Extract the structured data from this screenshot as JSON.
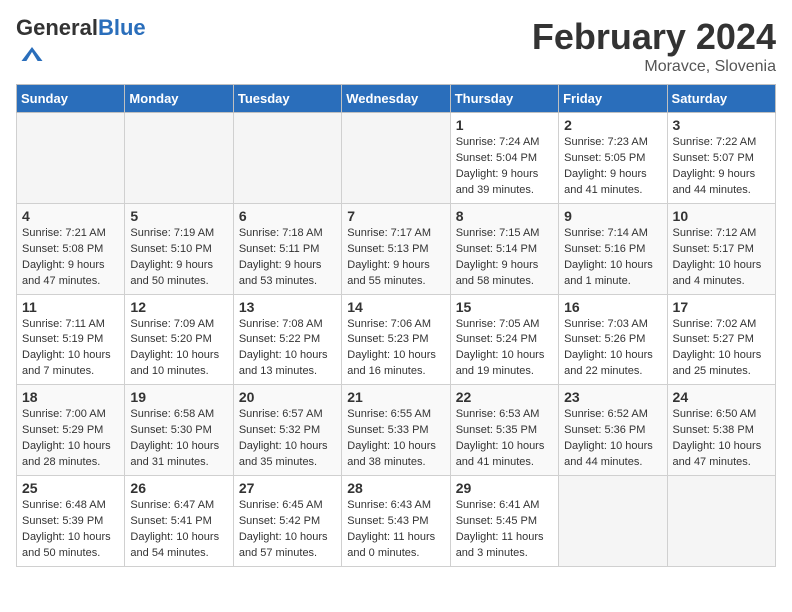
{
  "header": {
    "logo_general": "General",
    "logo_blue": "Blue",
    "month_title": "February 2024",
    "location": "Moravce, Slovenia"
  },
  "days_of_week": [
    "Sunday",
    "Monday",
    "Tuesday",
    "Wednesday",
    "Thursday",
    "Friday",
    "Saturday"
  ],
  "weeks": [
    [
      {
        "day": "",
        "empty": true
      },
      {
        "day": "",
        "empty": true
      },
      {
        "day": "",
        "empty": true
      },
      {
        "day": "",
        "empty": true
      },
      {
        "day": "1",
        "sunrise": "7:24 AM",
        "sunset": "5:04 PM",
        "daylight": "9 hours and 39 minutes."
      },
      {
        "day": "2",
        "sunrise": "7:23 AM",
        "sunset": "5:05 PM",
        "daylight": "9 hours and 41 minutes."
      },
      {
        "day": "3",
        "sunrise": "7:22 AM",
        "sunset": "5:07 PM",
        "daylight": "9 hours and 44 minutes."
      }
    ],
    [
      {
        "day": "4",
        "sunrise": "7:21 AM",
        "sunset": "5:08 PM",
        "daylight": "9 hours and 47 minutes."
      },
      {
        "day": "5",
        "sunrise": "7:19 AM",
        "sunset": "5:10 PM",
        "daylight": "9 hours and 50 minutes."
      },
      {
        "day": "6",
        "sunrise": "7:18 AM",
        "sunset": "5:11 PM",
        "daylight": "9 hours and 53 minutes."
      },
      {
        "day": "7",
        "sunrise": "7:17 AM",
        "sunset": "5:13 PM",
        "daylight": "9 hours and 55 minutes."
      },
      {
        "day": "8",
        "sunrise": "7:15 AM",
        "sunset": "5:14 PM",
        "daylight": "9 hours and 58 minutes."
      },
      {
        "day": "9",
        "sunrise": "7:14 AM",
        "sunset": "5:16 PM",
        "daylight": "10 hours and 1 minute."
      },
      {
        "day": "10",
        "sunrise": "7:12 AM",
        "sunset": "5:17 PM",
        "daylight": "10 hours and 4 minutes."
      }
    ],
    [
      {
        "day": "11",
        "sunrise": "7:11 AM",
        "sunset": "5:19 PM",
        "daylight": "10 hours and 7 minutes."
      },
      {
        "day": "12",
        "sunrise": "7:09 AM",
        "sunset": "5:20 PM",
        "daylight": "10 hours and 10 minutes."
      },
      {
        "day": "13",
        "sunrise": "7:08 AM",
        "sunset": "5:22 PM",
        "daylight": "10 hours and 13 minutes."
      },
      {
        "day": "14",
        "sunrise": "7:06 AM",
        "sunset": "5:23 PM",
        "daylight": "10 hours and 16 minutes."
      },
      {
        "day": "15",
        "sunrise": "7:05 AM",
        "sunset": "5:24 PM",
        "daylight": "10 hours and 19 minutes."
      },
      {
        "day": "16",
        "sunrise": "7:03 AM",
        "sunset": "5:26 PM",
        "daylight": "10 hours and 22 minutes."
      },
      {
        "day": "17",
        "sunrise": "7:02 AM",
        "sunset": "5:27 PM",
        "daylight": "10 hours and 25 minutes."
      }
    ],
    [
      {
        "day": "18",
        "sunrise": "7:00 AM",
        "sunset": "5:29 PM",
        "daylight": "10 hours and 28 minutes."
      },
      {
        "day": "19",
        "sunrise": "6:58 AM",
        "sunset": "5:30 PM",
        "daylight": "10 hours and 31 minutes."
      },
      {
        "day": "20",
        "sunrise": "6:57 AM",
        "sunset": "5:32 PM",
        "daylight": "10 hours and 35 minutes."
      },
      {
        "day": "21",
        "sunrise": "6:55 AM",
        "sunset": "5:33 PM",
        "daylight": "10 hours and 38 minutes."
      },
      {
        "day": "22",
        "sunrise": "6:53 AM",
        "sunset": "5:35 PM",
        "daylight": "10 hours and 41 minutes."
      },
      {
        "day": "23",
        "sunrise": "6:52 AM",
        "sunset": "5:36 PM",
        "daylight": "10 hours and 44 minutes."
      },
      {
        "day": "24",
        "sunrise": "6:50 AM",
        "sunset": "5:38 PM",
        "daylight": "10 hours and 47 minutes."
      }
    ],
    [
      {
        "day": "25",
        "sunrise": "6:48 AM",
        "sunset": "5:39 PM",
        "daylight": "10 hours and 50 minutes."
      },
      {
        "day": "26",
        "sunrise": "6:47 AM",
        "sunset": "5:41 PM",
        "daylight": "10 hours and 54 minutes."
      },
      {
        "day": "27",
        "sunrise": "6:45 AM",
        "sunset": "5:42 PM",
        "daylight": "10 hours and 57 minutes."
      },
      {
        "day": "28",
        "sunrise": "6:43 AM",
        "sunset": "5:43 PM",
        "daylight": "11 hours and 0 minutes."
      },
      {
        "day": "29",
        "sunrise": "6:41 AM",
        "sunset": "5:45 PM",
        "daylight": "11 hours and 3 minutes."
      },
      {
        "day": "",
        "empty": true
      },
      {
        "day": "",
        "empty": true
      }
    ]
  ]
}
